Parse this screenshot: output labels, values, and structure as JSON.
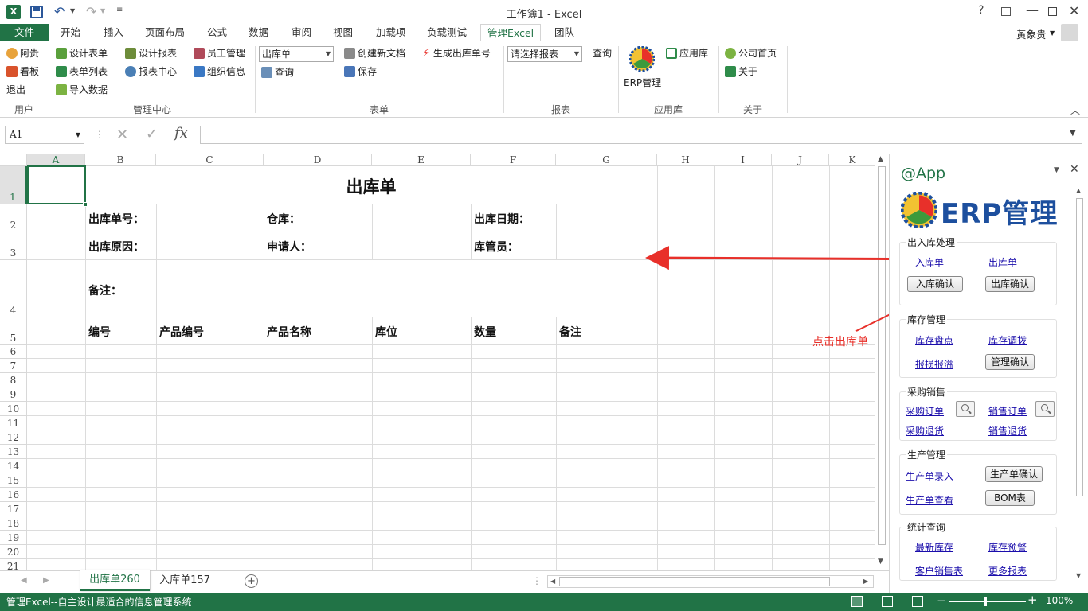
{
  "window": {
    "title": "工作簿1 - Excel",
    "user": "黃象贵"
  },
  "tabs": [
    "文件",
    "开始",
    "插入",
    "页面布局",
    "公式",
    "数据",
    "审阅",
    "视图",
    "加载项",
    "负载测试",
    "管理Excel",
    "团队"
  ],
  "ribbon": {
    "user_group": {
      "label": "用户",
      "items": [
        "阿贵",
        "看板",
        "退出"
      ]
    },
    "mgmt_group": {
      "label": "管理中心",
      "items": [
        "设计表单",
        "表单列表",
        "导入数据",
        "设计报表",
        "报表中心",
        "员工管理",
        "组织信息"
      ]
    },
    "form_group": {
      "label": "表单",
      "combo": "出库单",
      "query": "查询",
      "new_doc": "创建新文档",
      "save": "保存",
      "gen": "生成出库单号"
    },
    "report_group": {
      "label": "报表",
      "combo": "请选择报表",
      "query": "查询"
    },
    "app_group": {
      "label": "应用库",
      "erp": "ERP管理",
      "apps": "应用库"
    },
    "about_group": {
      "label": "关于",
      "home": "公司首页",
      "about": "关于"
    }
  },
  "formula": {
    "namebox": "A1",
    "fx": "fx"
  },
  "columns": [
    "A",
    "B",
    "C",
    "D",
    "E",
    "F",
    "G",
    "H",
    "I",
    "J",
    "K"
  ],
  "rows": [
    "1",
    "2",
    "3",
    "4",
    "5",
    "6",
    "7",
    "8",
    "9",
    "10",
    "11",
    "12",
    "13",
    "14",
    "15",
    "16",
    "17",
    "18",
    "19",
    "20",
    "21"
  ],
  "sheet": {
    "title": "出库单",
    "no_label": "出库单号：",
    "warehouse_label": "仓库：",
    "date_label": "出库日期：",
    "reason_label": "出库原因：",
    "applicant_label": "申请人：",
    "keeper_label": "库管员：",
    "note_label": "备注：",
    "headers": [
      "编号",
      "产品编号",
      "产品名称",
      "库位",
      "数量",
      "备注"
    ]
  },
  "annotation": "点击出库单",
  "sheet_tabs": [
    "出库单260",
    "入库单157"
  ],
  "panel": {
    "title": "@App",
    "logo_text": "ERP管理",
    "groups": {
      "inout": {
        "title": "出入库处理",
        "link1": "入库单",
        "link2": "出库单",
        "btn1": "入库确认",
        "btn2": "出库确认"
      },
      "stock": {
        "title": "库存管理",
        "link1": "库存盘点",
        "link2": "库存调拨",
        "link3": "报损报溢",
        "btn1": "管理确认"
      },
      "purchase": {
        "title": "采购销售",
        "link1": "采购订单",
        "link2": "销售订单",
        "link3": "采购退货",
        "link4": "销售退货"
      },
      "production": {
        "title": "生产管理",
        "link1": "生产单录入",
        "link2": "生产单查看",
        "btn1": "生产单确认",
        "btn2": "BOM表"
      },
      "stats": {
        "title": "统计查询",
        "link1": "最新库存",
        "link2": "库存预警",
        "link3": "客户销售表",
        "link4": "更多报表"
      }
    }
  },
  "status": {
    "text": "管理Excel--自主设计最适合的信息管理系统",
    "zoom": "100%"
  },
  "colors": {
    "excel_green": "#217346",
    "link": "#1a0dab",
    "arrow": "#e8302a"
  }
}
